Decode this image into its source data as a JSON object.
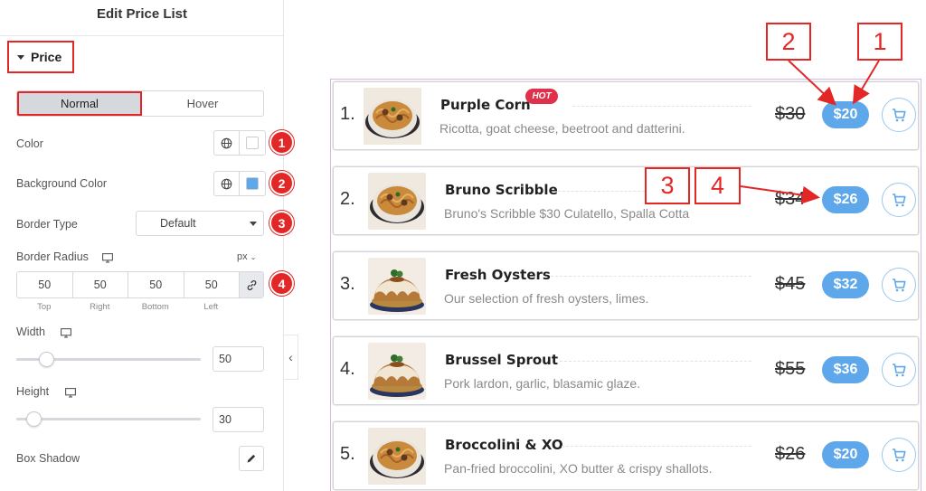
{
  "panel": {
    "title": "Edit Price List",
    "section": "Price",
    "tabs": [
      {
        "label": "Normal",
        "active": true
      },
      {
        "label": "Hover",
        "active": false
      }
    ],
    "color_label": "Color",
    "bg_color_label": "Background Color",
    "border_type_label": "Border Type",
    "border_type_value": "Default",
    "border_radius_label": "Border Radius",
    "unit": "px",
    "radius": {
      "top": "50",
      "right": "50",
      "bottom": "50",
      "left": "50"
    },
    "radius_labels": {
      "top": "Top",
      "right": "Right",
      "bottom": "Bottom",
      "left": "Left"
    },
    "width_label": "Width",
    "width_value": "50",
    "height_label": "Height",
    "height_value": "30",
    "box_shadow_label": "Box Shadow",
    "colors": {
      "swatch_color": "#ffffff",
      "swatch_bg": "#5da7ea",
      "accent_red": "#e32626"
    }
  },
  "badges": [
    "1",
    "2",
    "3",
    "4"
  ],
  "callouts": [
    "2",
    "1",
    "3",
    "4"
  ],
  "items": [
    {
      "num": "1.",
      "name": "Purple Corn",
      "desc": "Ricotta, goat cheese, beetroot and datterini.",
      "old": "$30",
      "price": "$20",
      "hot": "HOT",
      "image": "noodle-dish"
    },
    {
      "num": "2.",
      "name": "Bruno Scribble",
      "desc": "Bruno's Scribble $30 Culatello, Spalla Cotta",
      "old": "$34",
      "price": "$26",
      "image": "noodle-dish"
    },
    {
      "num": "3.",
      "name": "Fresh Oysters",
      "desc": "Our selection of fresh oysters, limes.",
      "old": "$45",
      "price": "$32",
      "image": "bundt-cake"
    },
    {
      "num": "4.",
      "name": "Brussel Sprout",
      "desc": "Pork lardon, garlic, blasamic glaze.",
      "old": "$55",
      "price": "$36",
      "image": "bundt-cake"
    },
    {
      "num": "5.",
      "name": "Broccolini & XO",
      "desc": "Pan-fried broccolini, XO butter & crispy shallots.",
      "old": "$26",
      "price": "$20",
      "image": "noodle-dish"
    }
  ]
}
